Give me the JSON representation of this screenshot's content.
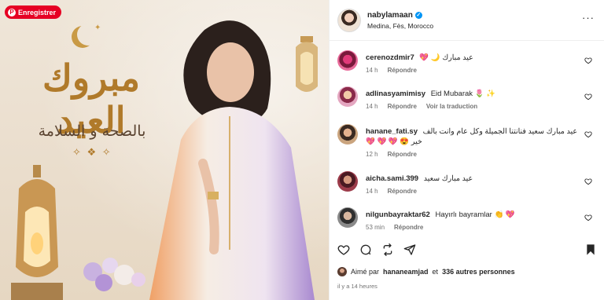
{
  "photo": {
    "save_button": "Enregistrer",
    "title_ar": "مبروك العيد",
    "subtitle_ar": "بالصحة و السلامة"
  },
  "header": {
    "username": "nabylamaan",
    "location": "Medina, Fès, Morocco"
  },
  "comments": [
    {
      "user": "cerenozdmir7",
      "text": "💖 🌙 عيد مبارك",
      "age": "14 h",
      "reply": "Répondre",
      "translate": ""
    },
    {
      "user": "adlinasyamimisy",
      "text": "Eid Mubarak 🌷 ✨",
      "age": "14 h",
      "reply": "Répondre",
      "translate": "Voir la traduction"
    },
    {
      "user": "hanane_fati.sy",
      "text": "عيد مبارك سعيد فنانتنا الجميلة وكل عام وانت بالف خير 😍 💖 💖 💖",
      "age": "12 h",
      "reply": "Répondre",
      "translate": ""
    },
    {
      "user": "aicha.sami.399",
      "text": "عيد مبارك سعيد",
      "age": "14 h",
      "reply": "Répondre",
      "translate": ""
    },
    {
      "user": "nilgunbayraktar62",
      "text": "Hayırlı bayramlar 👏 💖",
      "age": "53 min",
      "reply": "Répondre",
      "translate": ""
    }
  ],
  "likes": {
    "prefix": "Aimé par",
    "user": "hananeamjad",
    "middle": "et",
    "others": "336 autres personnes"
  },
  "timestamp": "il y a 14 heures",
  "icons": {
    "like": "heart-icon",
    "comment": "comment-icon",
    "share": "share-icon",
    "repost": "repost-icon",
    "save": "bookmark-icon",
    "more": "more-icon"
  },
  "colors": {
    "verified": "#0095f6",
    "pinterest": "#e60023",
    "meta_text": "#737373"
  }
}
